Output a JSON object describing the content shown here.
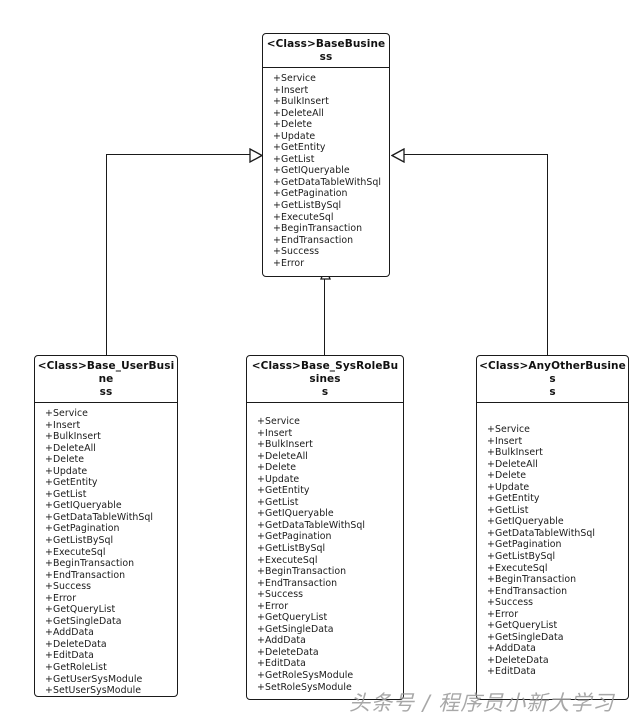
{
  "diagram": {
    "type": "uml-class-diagram",
    "relationship": "generalization",
    "classes": [
      {
        "id": "base-business",
        "stereotype": "<Class>",
        "name": "BaseBusiness",
        "title": "<Class>BaseBusiness",
        "members": [
          "+ Service",
          "+ Insert",
          "+ BulkInsert",
          "+ DeleteAll",
          "+ Delete",
          "+ Update",
          "+ GetEntity",
          "+ GetList",
          "+ GetIQueryable",
          "+ GetDataTableWithSql",
          "+ GetPagination",
          "+ GetListBySql",
          "+ ExecuteSql",
          "+ BeginTransaction",
          "+ EndTransaction",
          "+ Success",
          "+ Error"
        ]
      },
      {
        "id": "base-user-business",
        "stereotype": "<Class>",
        "name": "Base_UserBusiness",
        "title": "<Class>Base_UserBusine\nss",
        "members": [
          "+ Service",
          "+ Insert",
          "+ BulkInsert",
          "+ DeleteAll",
          "+ Delete",
          "+ Update",
          "+ GetEntity",
          "+ GetList",
          "+ GetIQueryable",
          "+ GetDataTableWithSql",
          "+ GetPagination",
          "+ GetListBySql",
          "+ ExecuteSql",
          "+ BeginTransaction",
          "+ EndTransaction",
          "+ Success",
          "+ Error",
          "+ GetQueryList",
          "+ GetSingleData",
          "+ AddData",
          "+ DeleteData",
          "+ EditData",
          "+ GetRoleList",
          "+ GetUserSysModule",
          "+ SetUserSysModule"
        ]
      },
      {
        "id": "base-sysrole-business",
        "stereotype": "<Class>",
        "name": "Base_SysRoleBusiness",
        "title": "<Class>Base_SysRoleBusines\ns",
        "members": [
          "+ Service",
          "+ Insert",
          "+ BulkInsert",
          "+ DeleteAll",
          "+ Delete",
          "+ Update",
          "+ GetEntity",
          "+ GetList",
          "+ GetIQueryable",
          "+ GetDataTableWithSql",
          "+ GetPagination",
          "+ GetListBySql",
          "+ ExecuteSql",
          "+ BeginTransaction",
          "+ EndTransaction",
          "+ Success",
          "+ Error",
          "+ GetQueryList",
          "+ GetSingleData",
          "+ AddData",
          "+ DeleteData",
          "+ EditData",
          "+ GetRoleSysModule",
          "+ SetRoleSysModule"
        ]
      },
      {
        "id": "any-other-business",
        "stereotype": "<Class>",
        "name": "AnyOtherBusiness",
        "title": "<Class>AnyOtherBusines\ns",
        "members": [
          "+ Service",
          "+ Insert",
          "+ BulkInsert",
          "+ DeleteAll",
          "+ Delete",
          "+ Update",
          "+ GetEntity",
          "+ GetList",
          "+ GetIQueryable",
          "+ GetDataTableWithSql",
          "+ GetPagination",
          "+ GetListBySql",
          "+ ExecuteSql",
          "+ BeginTransaction",
          "+ EndTransaction",
          "+ Success",
          "+ Error",
          "+ GetQueryList",
          "+ GetSingleData",
          "+ AddData",
          "+ DeleteData",
          "+ EditData"
        ]
      }
    ]
  },
  "watermark": {
    "text": "头条号 / 程序员小新大学习"
  },
  "colors": {
    "stroke": "#1a1a1a",
    "text": "#1b1b1b",
    "background": "#ffffff",
    "watermark": "#9a9a9a"
  }
}
